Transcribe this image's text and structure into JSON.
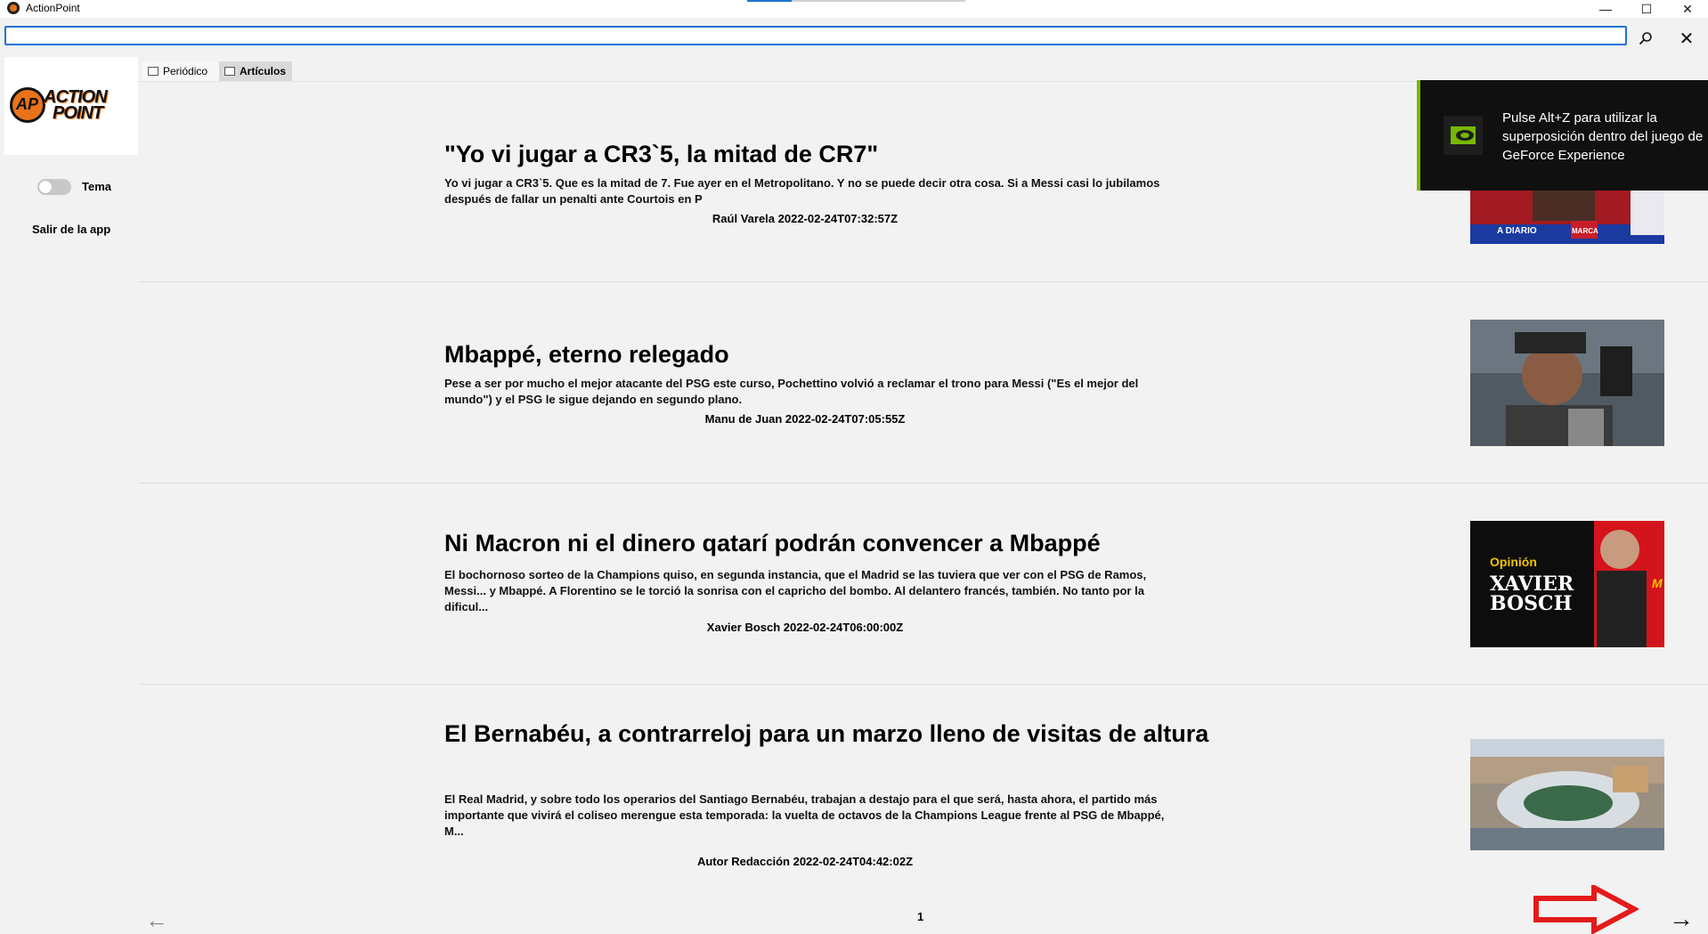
{
  "window": {
    "title": "ActionPoint",
    "minimize_glyph": "—",
    "maximize_glyph": "☐",
    "close_glyph": "✕"
  },
  "search": {
    "value": "",
    "placeholder": "",
    "search_icon": "search-icon",
    "clear_glyph": "✕"
  },
  "sidebar": {
    "logo_mark": "AP",
    "logo_line1": "ACTION",
    "logo_line2": "POINT",
    "theme_label": "Tema",
    "theme_on": false,
    "exit_label": "Salir de la app"
  },
  "tabs": [
    {
      "label": "Periódico",
      "icon": "newspaper-icon",
      "selected": false
    },
    {
      "label": "Artículos",
      "icon": "articles-icon",
      "selected": true
    }
  ],
  "articles": [
    {
      "title": "\"Yo vi jugar a CR3`5, la mitad de CR7\"",
      "description": "Yo vi jugar a CR3`5. Que es la mitad de 7. Fue ayer en el Metropolitano. Y no se puede decir otra cosa. Si a Messi casi lo jubilamos después de fallar un penalti ante Courtois en P",
      "meta": "Raúl Varela 2022-02-24T07:32:57Z",
      "thumb_caption": "A DIARIO",
      "thumb_badge": "MARCA"
    },
    {
      "title": "Mbappé, eterno relegado",
      "description": "Pese a ser por mucho el mejor atacante del PSG este curso, Pochettino volvió a reclamar el trono para Messi (\"Es el mejor del mundo\") y el PSG le sigue dejando en segundo plano.",
      "meta": "Manu de Juan 2022-02-24T07:05:55Z"
    },
    {
      "title": "Ni Macron ni el dinero qatarí podrán convencer a Mbappé",
      "description": "El bochornoso sorteo de la Champions quiso, en segunda instancia, que el Madrid se las tuviera que ver con el PSG de Ramos, Messi... y Mbappé. A Florentino se le torció la sonrisa con el capricho del bombo. Al delantero francés, también. No tanto por la dificul...",
      "meta": "Xavier Bosch 2022-02-24T06:00:00Z",
      "thumb_kicker": "Opinión",
      "thumb_name1": "XAVIER",
      "thumb_name2": "BOSCH",
      "thumb_corner": "M"
    },
    {
      "title": "El Bernabéu, a contrarreloj para un marzo lleno de visitas de altura",
      "description": "El Real Madrid, y sobre todo los operarios del Santiago Bernabéu, trabajan a destajo para el que será, hasta ahora, el partido más importante que vivirá el coliseo merengue esta temporada: la vuelta de octavos de la Champions League frente al PSG de Mbappé, M...",
      "meta": "Autor Redacción 2022-02-24T04:42:02Z"
    }
  ],
  "pagination": {
    "prev_glyph": "←",
    "page": "1",
    "next_glyph": "→"
  },
  "overlay": {
    "text": "Pulse Alt+Z para utilizar la superposición dentro del juego de GeForce Experience"
  },
  "colors": {
    "accent": "#1e73d2",
    "annotation_arrow": "#e31b1b",
    "nvidia_green": "#76b900"
  }
}
